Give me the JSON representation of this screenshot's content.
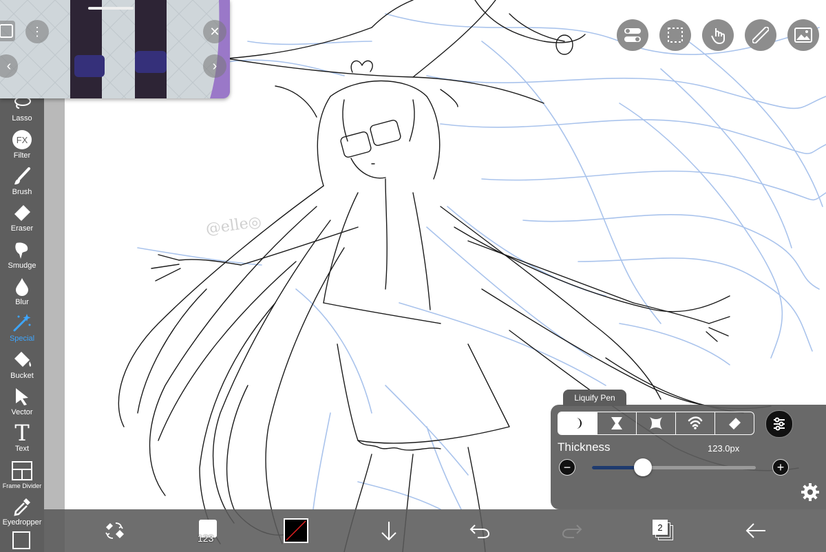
{
  "toolbar": {
    "tools": [
      {
        "id": "lasso",
        "label": "Lasso"
      },
      {
        "id": "filter",
        "label": "Filter",
        "icon_text": "FX"
      },
      {
        "id": "brush",
        "label": "Brush"
      },
      {
        "id": "eraser",
        "label": "Eraser"
      },
      {
        "id": "smudge",
        "label": "Smudge"
      },
      {
        "id": "blur",
        "label": "Blur"
      },
      {
        "id": "special",
        "label": "Special",
        "active": true
      },
      {
        "id": "bucket",
        "label": "Bucket"
      },
      {
        "id": "vector",
        "label": "Vector"
      },
      {
        "id": "text",
        "label": "Text",
        "icon_text": "T"
      },
      {
        "id": "frame-divider",
        "label": "Frame Divider"
      },
      {
        "id": "eyedropper",
        "label": "Eyedropper"
      }
    ],
    "active_color": "#3ea6ff"
  },
  "liquify": {
    "title": "Liquify Pen",
    "modes": [
      "pull",
      "pinch",
      "expand",
      "twirl",
      "eraser"
    ],
    "thickness_label": "Thickness",
    "thickness_value": "123.0px",
    "thickness_fraction": 0.31
  },
  "bottom_bar": {
    "brush_size": "123",
    "layer_count": "2"
  },
  "colors": {
    "sketch_blue": "#a9c3ec",
    "line_black": "#1a1a1a",
    "slider_fill": "#1e3a6e"
  },
  "top_buttons": [
    "toggle-icon",
    "selection-icon",
    "touch-icon",
    "ruler-icon",
    "gallery-icon"
  ]
}
